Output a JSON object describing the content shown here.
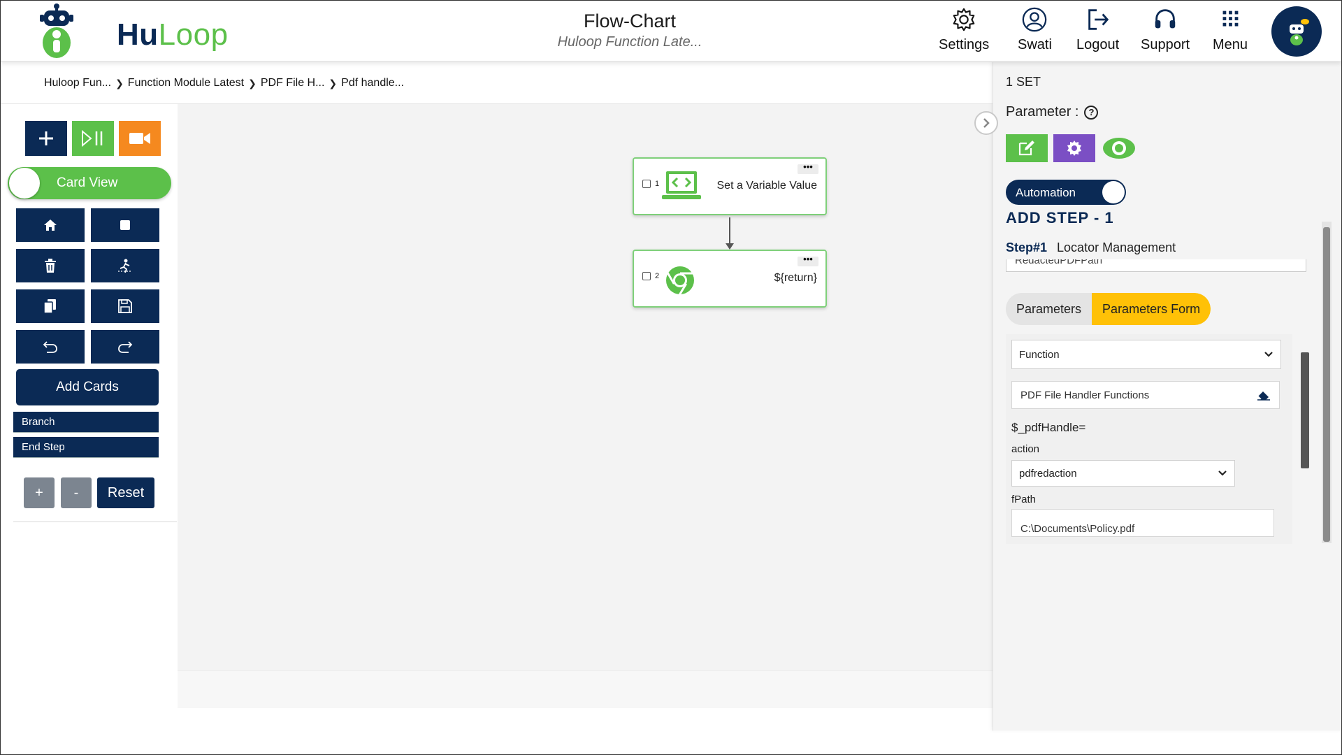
{
  "header": {
    "logo": {
      "part1": "Hu",
      "part2": "Loop"
    },
    "title": "Flow-Chart",
    "subtitle": "Huloop Function Late...",
    "nav": [
      {
        "label": "Settings",
        "icon": "gear-icon"
      },
      {
        "label": "Swati",
        "icon": "user-icon"
      },
      {
        "label": "Logout",
        "icon": "logout-icon"
      },
      {
        "label": "Support",
        "icon": "headset-icon"
      },
      {
        "label": "Menu",
        "icon": "grid-icon"
      }
    ]
  },
  "breadcrumb": [
    "Huloop Fun...",
    "Function Module Latest",
    "PDF File H...",
    "Pdf handle..."
  ],
  "toolbar": {
    "card_view_label": "Card View",
    "add_cards_label": "Add Cards",
    "branch_label": "Branch",
    "end_step_label": "End Step",
    "zoom_in_label": "+",
    "zoom_out_label": "-",
    "reset_label": "Reset"
  },
  "canvas": {
    "cards": [
      {
        "number": "1",
        "text": "Set a Variable Value",
        "icon": "code-laptop-icon",
        "menu": "•••"
      },
      {
        "number": "2",
        "text": "${return}",
        "icon": "chrome-icon",
        "menu": "•••"
      }
    ]
  },
  "panel": {
    "set_label": "1 SET",
    "parameter_label": "Parameter :",
    "help_glyph": "?",
    "automation_label": "Automation",
    "add_step_title": "ADD STEP - 1",
    "step_id": "Step#1",
    "step_name": "Locator Management",
    "cut_field_value": "RedactedPDFPath",
    "tabs": [
      "Parameters",
      "Parameters Form"
    ],
    "function_select": "Function",
    "function_field": "PDF File Handler Functions",
    "handle_label": "$_pdfHandle=",
    "action_label": "action",
    "action_value": "pdfredaction",
    "fpath_label": "fPath",
    "fpath_value": "C:\\Documents\\Policy.pdf"
  },
  "colors": {
    "navy": "#0b2a55",
    "green": "#5cc04a",
    "orange": "#f5891f",
    "purple": "#7b4fc4",
    "yellow": "#ffc107"
  }
}
